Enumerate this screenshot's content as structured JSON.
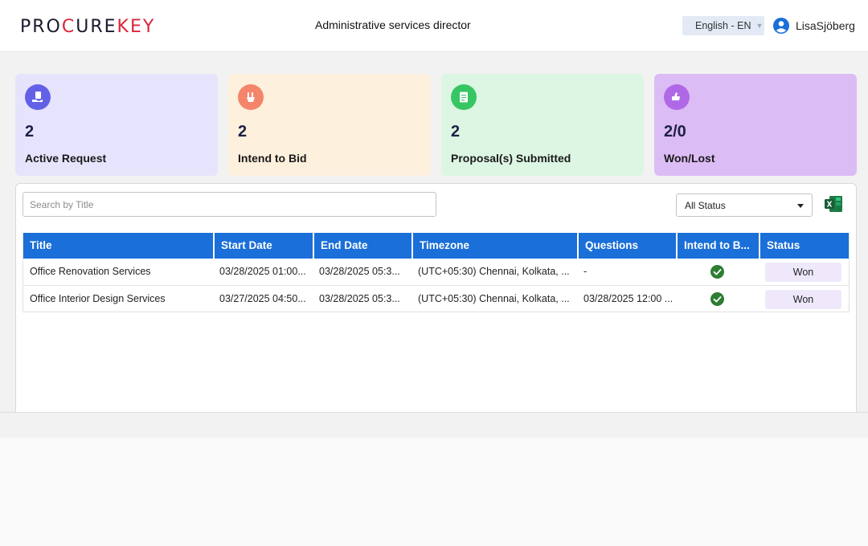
{
  "header": {
    "logo_left": "PRO",
    "logo_accent_1": "C",
    "logo_mid": "URE",
    "logo_accent_2": "KEY",
    "role_title": "Administrative services director",
    "language": "English - EN",
    "user_name": "LisaSjöberg"
  },
  "cards": [
    {
      "value": "2",
      "label": "Active Request",
      "icon": "hand-document-icon",
      "bg": "#e6e3fd",
      "icon_bg": "#6360e8"
    },
    {
      "value": "2",
      "label": "Intend to Bid",
      "icon": "hand-bid-icon",
      "bg": "#fdf0dc",
      "icon_bg": "#f4856b"
    },
    {
      "value": "2",
      "label": "Proposal(s) Submitted",
      "icon": "document-icon",
      "bg": "#dcf6e3",
      "icon_bg": "#36c663"
    },
    {
      "value": "2/0",
      "label": "Won/Lost",
      "icon": "thumbs-icon",
      "bg": "#dcbcf5",
      "icon_bg": "#b069e6"
    }
  ],
  "filters": {
    "search_placeholder": "Search by Title",
    "status_selected": "All Status"
  },
  "table": {
    "columns": [
      "Title",
      "Start Date",
      "End Date",
      "Timezone",
      "Questions",
      "Intend to B...",
      "Status"
    ],
    "rows": [
      {
        "title": "Office Renovation Services",
        "start": "03/28/2025 01:00...",
        "end": "03/28/2025 05:3...",
        "timezone": "(UTC+05:30) Chennai, Kolkata, ...",
        "questions": "-",
        "intend": true,
        "status": "Won"
      },
      {
        "title": "Office Interior Design Services",
        "start": "03/27/2025 04:50...",
        "end": "03/28/2025 05:3...",
        "timezone": "(UTC+05:30) Chennai, Kolkata, ...",
        "questions": "03/28/2025 12:00 ...",
        "intend": true,
        "status": "Won"
      }
    ]
  },
  "colors": {
    "table_header": "#1a6fd8",
    "check_green": "#2e7d32",
    "logo_accent": "#d9263a"
  }
}
